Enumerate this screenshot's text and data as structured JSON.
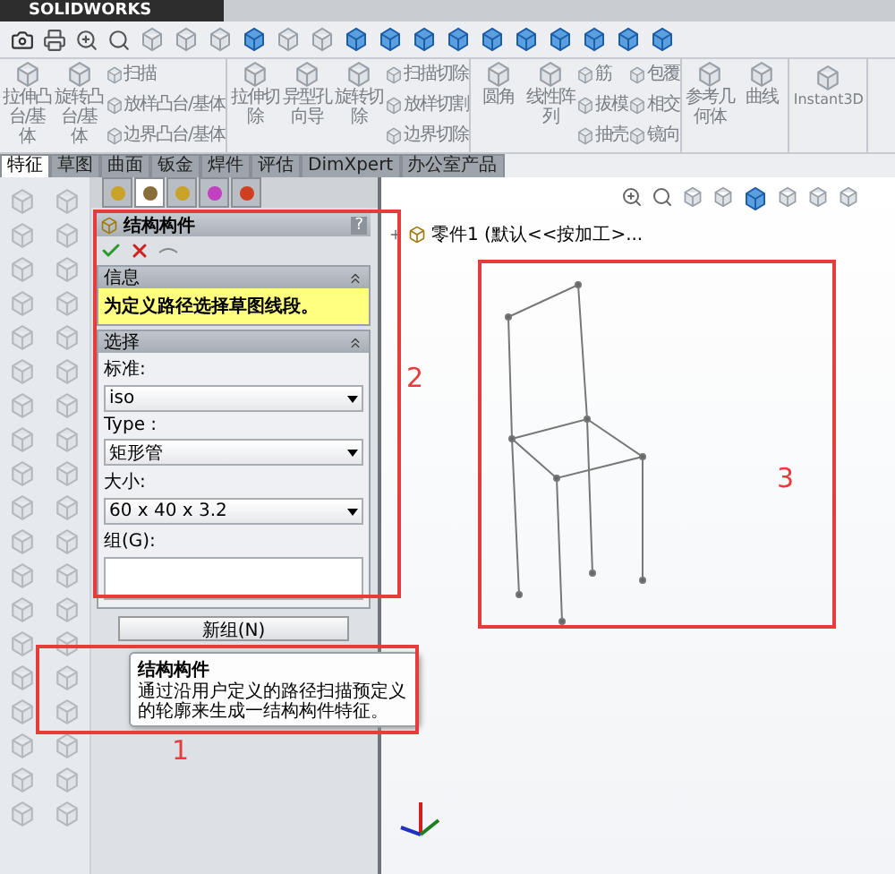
{
  "title_bar": {
    "title": "SOLIDWORKS"
  },
  "ribbon": {
    "groups": [
      {
        "items": [
          {
            "kind": "large",
            "label": "拉伸凸台/基体"
          },
          {
            "kind": "large",
            "label": "旋转凸台/基体"
          },
          {
            "kind": "stack",
            "labels": [
              "扫描",
              "放样凸台/基体",
              "边界凸台/基体"
            ]
          }
        ]
      },
      {
        "items": [
          {
            "kind": "large",
            "label": "拉伸切除"
          },
          {
            "kind": "large",
            "label": "异型孔向导"
          },
          {
            "kind": "large",
            "label": "旋转切除"
          },
          {
            "kind": "stack",
            "labels": [
              "扫描切除",
              "放样切割",
              "边界切除"
            ]
          }
        ]
      },
      {
        "items": [
          {
            "kind": "large",
            "label": "圆角"
          },
          {
            "kind": "large",
            "label": "线性阵列"
          },
          {
            "kind": "stack",
            "labels": [
              "筋",
              "拔模",
              "抽壳"
            ]
          },
          {
            "kind": "stack",
            "labels": [
              "包覆",
              "相交",
              "镜向"
            ]
          }
        ]
      },
      {
        "items": [
          {
            "kind": "large",
            "label": "参考几何体"
          },
          {
            "kind": "large",
            "label": "曲线"
          }
        ]
      },
      {
        "items": [
          {
            "kind": "wide",
            "label": "Instant3D"
          }
        ]
      }
    ]
  },
  "tabs": [
    {
      "label": "特征",
      "selected": true
    },
    {
      "label": "草图",
      "selected": false
    },
    {
      "label": "曲面",
      "selected": false
    },
    {
      "label": "钣金",
      "selected": false
    },
    {
      "label": "焊件",
      "selected": false
    },
    {
      "label": "评估",
      "selected": false
    },
    {
      "label": "DimXpert",
      "selected": false
    },
    {
      "label": "办公室产品",
      "selected": false
    }
  ],
  "panel_tabs": [
    {
      "selected": false
    },
    {
      "selected": true
    },
    {
      "selected": false
    },
    {
      "selected": false
    },
    {
      "selected": false
    }
  ],
  "property_manager": {
    "title": "结构构件",
    "help": "?",
    "info": {
      "title": "信息",
      "expanded": true,
      "message": "为定义路径选择草图线段。"
    },
    "selection": {
      "title": "选择",
      "expanded": true,
      "fields": [
        {
          "label": "标准:",
          "value": "iso"
        },
        {
          "label": "Type :",
          "value": "矩形管"
        },
        {
          "label": "大小:",
          "value": "60 x 40 x 3.2"
        }
      ],
      "group_label": "组(G):",
      "button": "新组(N)"
    }
  },
  "tooltip": {
    "title": "结构构件",
    "text": "通过沿用户定义的路径扫描预定义的轮廓来生成一结构构件特征。"
  },
  "graphics": {
    "tree_item": "零件1 (默认<<按加工>..."
  },
  "annotations": [
    {
      "label": "1"
    },
    {
      "label": "2"
    },
    {
      "label": "3"
    }
  ]
}
